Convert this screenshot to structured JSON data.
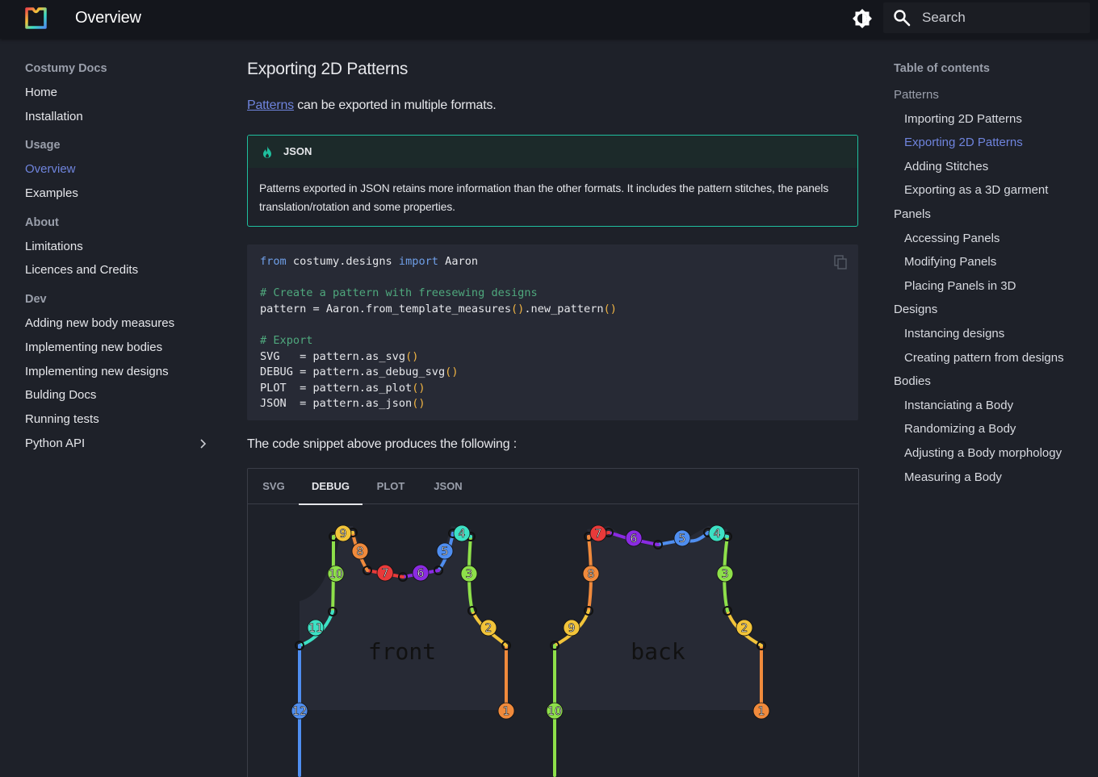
{
  "header": {
    "title": "Overview",
    "search_placeholder": "Search"
  },
  "leftnav": {
    "site_title": "Costumy Docs",
    "sections": [
      {
        "title": "",
        "items": [
          {
            "label": "Home"
          },
          {
            "label": "Installation"
          }
        ]
      },
      {
        "title": "Usage",
        "items": [
          {
            "label": "Overview",
            "active": true
          },
          {
            "label": "Examples"
          }
        ]
      },
      {
        "title": "About",
        "items": [
          {
            "label": "Limitations"
          },
          {
            "label": "Licences and Credits"
          }
        ]
      },
      {
        "title": "Dev",
        "items": [
          {
            "label": "Adding new body measures"
          },
          {
            "label": "Implementing new bodies"
          },
          {
            "label": "Implementing new designs"
          },
          {
            "label": "Bulding Docs"
          },
          {
            "label": "Running tests"
          },
          {
            "label": "Python API",
            "expandable": true
          }
        ]
      }
    ]
  },
  "toc": {
    "title": "Table of contents",
    "groups": [
      {
        "label": "Patterns",
        "muted": true,
        "items": [
          {
            "label": "Importing 2D Patterns"
          },
          {
            "label": "Exporting 2D Patterns",
            "active": true
          },
          {
            "label": "Adding Stitches"
          },
          {
            "label": "Exporting as a 3D garment"
          }
        ]
      },
      {
        "label": "Panels",
        "items": [
          {
            "label": "Accessing Panels"
          },
          {
            "label": "Modifying Panels"
          },
          {
            "label": "Placing Panels in 3D"
          }
        ]
      },
      {
        "label": "Designs",
        "items": [
          {
            "label": "Instancing designs"
          },
          {
            "label": "Creating pattern from designs"
          }
        ]
      },
      {
        "label": "Bodies",
        "items": [
          {
            "label": "Instanciating a Body"
          },
          {
            "label": "Randomizing a Body"
          },
          {
            "label": "Adjusting a Body morphology"
          },
          {
            "label": "Measuring a Body"
          }
        ]
      }
    ]
  },
  "main": {
    "title": "Exporting 2D Patterns",
    "intro_link": "Patterns",
    "intro_rest": " can be exported in multiple formats.",
    "admonition": {
      "title": "JSON",
      "body": "Patterns exported in JSON retains more information than the other formats. It includes the pattern stitches, the panels translation/rotation and some properties."
    },
    "code_lines": [
      "from costumy.designs import Aaron",
      "",
      "# Create a pattern with freesewing designs",
      "pattern = Aaron.from_template_measures().new_pattern()",
      "",
      "# Export",
      "SVG   = pattern.as_svg()",
      "DEBUG = pattern.as_debug_svg()",
      "PLOT  = pattern.as_plot()",
      "JSON  = pattern.as_json()"
    ],
    "snippet_text": "The code snippet above produces the following :",
    "tabs": [
      {
        "label": "SVG"
      },
      {
        "label": "DEBUG",
        "active": true
      },
      {
        "label": "PLOT"
      },
      {
        "label": "JSON"
      }
    ],
    "panels": [
      {
        "name": "front",
        "edge_labels": [
          "1",
          "2",
          "3",
          "4",
          "5",
          "6",
          "7",
          "8",
          "9",
          "10",
          "11",
          "12"
        ]
      },
      {
        "name": "back",
        "edge_labels": [
          "1",
          "2",
          "3",
          "4",
          "5",
          "6",
          "7",
          "8",
          "9",
          "10"
        ]
      }
    ]
  },
  "colors": {
    "accent": "#6f84dd",
    "admonition_border": "#1fbf9e",
    "edge_orange": "#f08a3c",
    "edge_yellow": "#f2c43a",
    "edge_green": "#8ee04a",
    "edge_cyan": "#3de0c4",
    "edge_blue": "#4f8ef0",
    "edge_purple": "#8a2be2",
    "edge_red": "#e83a3a"
  }
}
